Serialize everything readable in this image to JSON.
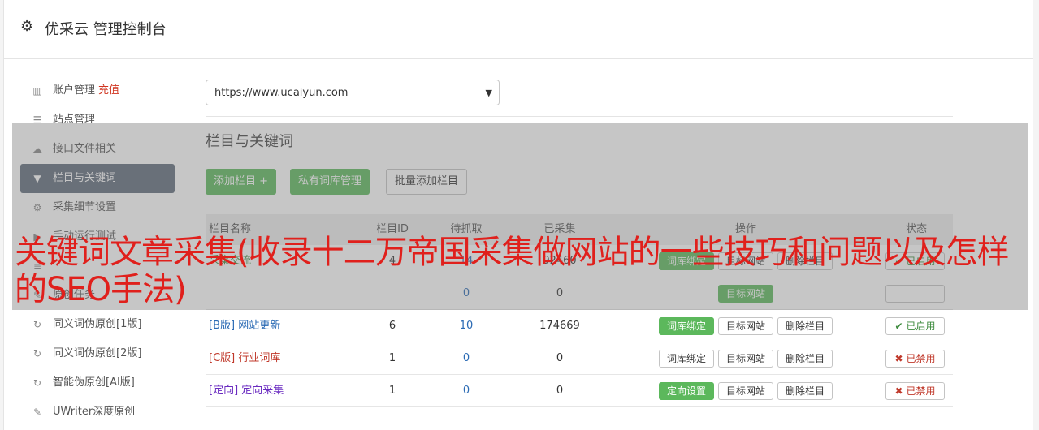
{
  "app": {
    "title": "优采云 管理控制台",
    "icon": "gear-icon"
  },
  "sidebar": {
    "items": [
      {
        "label": "账户管理",
        "extra": "充值",
        "icon": "bar-chart-icon"
      },
      {
        "label": "站点管理",
        "icon": "server-icon"
      },
      {
        "label": "接口文件相关",
        "icon": "cloud-upload-icon"
      },
      {
        "label": "栏目与关键词",
        "icon": "filter-icon",
        "active": true
      },
      {
        "label": "采集细节设置",
        "icon": "gears-icon"
      },
      {
        "label": "手动运行测试",
        "icon": "play-icon"
      },
      {
        "label": "",
        "icon": "list-icon"
      },
      {
        "label": "原创任务",
        "icon": "edit-icon"
      },
      {
        "label": "同义词伪原创[1版]",
        "icon": "refresh-icon"
      },
      {
        "label": "同义词伪原创[2版]",
        "icon": "refresh-icon"
      },
      {
        "label": "智能伪原创[AI版]",
        "icon": "refresh-icon"
      },
      {
        "label": "UWriter深度原创",
        "icon": "pencil-icon"
      }
    ]
  },
  "main": {
    "site_select": {
      "value": "https://www.ucaiyun.com"
    },
    "section_title": "栏目与关键词",
    "buttons": {
      "add": "添加栏目 +",
      "private_lib": "私有词库管理",
      "batch_add": "批量添加栏目"
    },
    "table": {
      "headers": {
        "name": "栏目名称",
        "id": "栏目ID",
        "wait": "待抓取",
        "done": "已采集",
        "ops": "操作",
        "status": "状态"
      },
      "rows": [
        {
          "name": "采集交流",
          "id": "4",
          "wait": "14",
          "done": "92460",
          "op1": "词库绑定",
          "op2": "目标网站",
          "op3": "删除栏目",
          "status": "已启用"
        },
        {
          "name": "",
          "id": "",
          "wait": "0",
          "done": "0",
          "op1": "",
          "op2": "目标网站",
          "op3": "",
          "status": ""
        },
        {
          "tag": "[B版]",
          "name": "网站更新",
          "id": "6",
          "wait": "10",
          "done": "174669",
          "op1": "词库绑定",
          "op2": "目标网站",
          "op3": "删除栏目",
          "status": "已启用"
        },
        {
          "tag": "[C版]",
          "name": "行业词库",
          "id": "1",
          "wait": "0",
          "done": "0",
          "op1": "词库绑定",
          "op2": "目标网站",
          "op3": "删除栏目",
          "status": "已禁用"
        },
        {
          "tag": "[定向]",
          "name": "定向采集",
          "id": "1",
          "wait": "0",
          "done": "0",
          "op1": "定向设置",
          "op2": "目标网站",
          "op3": "删除栏目",
          "status": "已禁用"
        }
      ]
    }
  },
  "overlay_headline": "关键词文章采集(收录十二万帝国采集做网站的一些技巧和问题以及怎样的SEO手法)",
  "colors": {
    "accent_green": "#5cb85c",
    "headline_red": "#e0201c",
    "active_nav": "#5f6b7a"
  }
}
